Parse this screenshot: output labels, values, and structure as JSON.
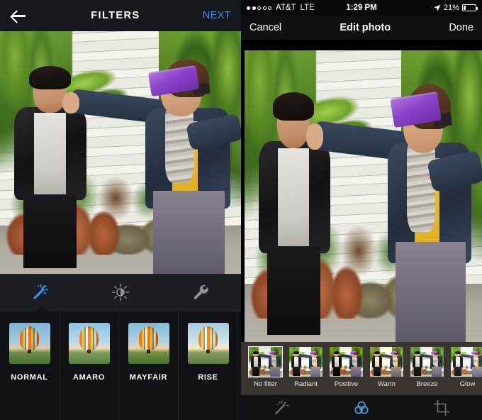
{
  "left_panel": {
    "nav": {
      "back_icon": "arrow-left-icon",
      "title": "FILTERS",
      "next_label": "NEXT",
      "next_color": "#3d92e8"
    },
    "tools": [
      {
        "name": "magic-wand-icon",
        "label": "Filters",
        "active": true,
        "color": "#3d92e8"
      },
      {
        "name": "brightness-icon",
        "label": "Lux",
        "active": false,
        "color": "#8c9298"
      },
      {
        "name": "wrench-icon",
        "label": "Adjust",
        "active": false,
        "color": "#8c9298"
      }
    ],
    "filters": [
      {
        "label": "NORMAL",
        "selected": true
      },
      {
        "label": "AMARO",
        "selected": false
      },
      {
        "label": "MAYFAIR",
        "selected": false
      },
      {
        "label": "RISE",
        "selected": false
      }
    ]
  },
  "right_panel": {
    "status_bar": {
      "signal_dots_filled": 2,
      "signal_dots_total": 5,
      "carrier": "AT&T",
      "network": "LTE",
      "time": "1:29 PM",
      "location_icon": "location-arrow-icon",
      "battery_percent": "21%",
      "battery_level": 21
    },
    "nav": {
      "cancel_label": "Cancel",
      "title": "Edit photo",
      "done_label": "Done"
    },
    "filters": [
      {
        "label": "No filter",
        "selected": true
      },
      {
        "label": "Radiant",
        "selected": false
      },
      {
        "label": "Positive",
        "selected": false
      },
      {
        "label": "Warm",
        "selected": false
      },
      {
        "label": "Breeze",
        "selected": false
      },
      {
        "label": "Glow",
        "selected": false
      }
    ],
    "tabbar": [
      {
        "name": "magic-wand-icon",
        "label": "Enhance",
        "active": false,
        "color": "#6e6e6e"
      },
      {
        "name": "filters-circles-icon",
        "label": "Filters",
        "active": true,
        "color": "#4aa3e8"
      },
      {
        "name": "crop-icon",
        "label": "Crop",
        "active": false,
        "color": "#6e6e6e"
      }
    ]
  }
}
